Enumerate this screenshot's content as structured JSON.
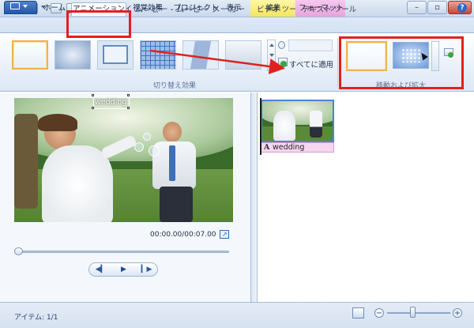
{
  "window": {
    "title": "マイ ムービー - ムービー メーカー",
    "context_tabs": [
      "ビデオ ツール",
      "テキスト ツール"
    ],
    "controls": {
      "minimize": "–",
      "maximize": "▫",
      "close": "✕"
    }
  },
  "ribbon": {
    "tabs": [
      "ホーム",
      "アニメーション",
      "視覚効果",
      "プロジェクト",
      "表示",
      "編集",
      "フォーマット"
    ],
    "active_tab": "アニメーション",
    "help": "?",
    "transitions": {
      "group_label": "切り替え効果",
      "apply_all_label": "すべてに適用",
      "selected": "none"
    },
    "pan_zoom": {
      "group_label": "移動および拡大",
      "selected": "none"
    }
  },
  "preview": {
    "caption_text": "wedding",
    "time_display": "00:00.00/00:07.00",
    "seek_position": 0,
    "transport": {
      "prev": "◀▎",
      "play": "▶",
      "next": "▎▶"
    }
  },
  "storyboard": {
    "clips": [
      {
        "caption": "wedding",
        "caption_icon": "A"
      }
    ]
  },
  "status": {
    "items_text": "アイテム: 1/1",
    "zoom_minus": "−",
    "zoom_plus": "+"
  },
  "annotation_color": "#e0211f"
}
